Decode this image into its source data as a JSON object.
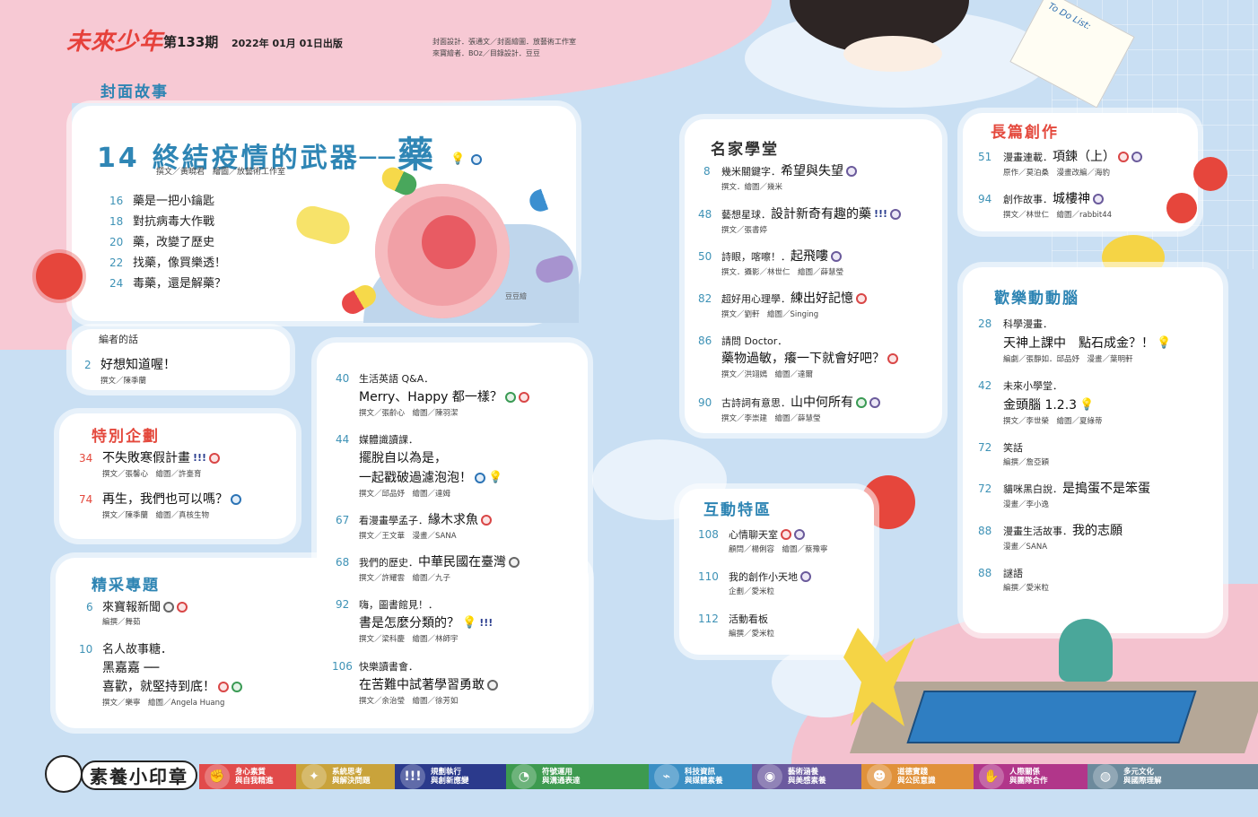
{
  "header": {
    "logo": "未來少年",
    "issue": "第133期",
    "date": "2022年 01月 01日出版",
    "credit_line1": "封面設計．張通文／封面繪圖．放藝術工作室",
    "credit_line2": "來寶繪者．BOz／目錄設計．豆豆"
  },
  "cover": {
    "section": "封面故事",
    "number": "14",
    "title": "終結疫情的武器──",
    "title_big": "藥",
    "credit": "撰文／黃曉君　繪圖／放藝術工作室",
    "items": [
      {
        "page": "16",
        "title": "藥是一把小鑰匙"
      },
      {
        "page": "18",
        "title": "對抗病毒大作戰"
      },
      {
        "page": "20",
        "title": "藥，改變了歷史"
      },
      {
        "page": "22",
        "title": "找藥，像買樂透！"
      },
      {
        "page": "24",
        "title": "毒藥，還是解藥？"
      }
    ],
    "illustrator_tag": "豆豆繪"
  },
  "editor": {
    "label": "編者的話",
    "page": "2",
    "title": "好想知道喔！",
    "credit": "撰文／陳季蘭"
  },
  "special": {
    "section": "特別企劃",
    "items": [
      {
        "page": "34",
        "title": "不失敗寒假計畫",
        "credit": "撰文／張馨心　繪圖／許臺育"
      },
      {
        "page": "74",
        "title": "再生，我們也可以嗎？",
        "credit": "撰文／陳季蘭　繪圖／真核生物"
      }
    ]
  },
  "feature": {
    "section": "精采專題",
    "items": [
      {
        "page": "6",
        "title": "來寶報新聞",
        "credit": "編撰／舞茹"
      },
      {
        "page": "10",
        "series": "名人故事糖．",
        "title1": "黑嘉嘉 ──",
        "title2": "喜歡，就堅持到底！",
        "credit": "撰文／樂寧　繪圖／Angela Huang"
      }
    ]
  },
  "middle": {
    "items": [
      {
        "page": "40",
        "series": "生活英語 Q&A．",
        "title": "Merry、Happy 都一樣？",
        "credit": "撰文／張齡心　繪圖／陳羽潔"
      },
      {
        "page": "44",
        "series": "媒體識讀課．",
        "title1": "擺脫自以為是，",
        "title2": "一起戳破過濾泡泡！",
        "credit": "撰文／邱品妤　繪圖／達姆"
      },
      {
        "page": "67",
        "series": "看漫畫學孟子．",
        "title": "緣木求魚",
        "credit": "撰文／王文華　漫畫／SANA"
      },
      {
        "page": "68",
        "series": "我們的歷史．",
        "title": "中華民國在臺灣",
        "credit": "撰文／許耀雲　繪圖／九子"
      },
      {
        "page": "92",
        "series": "嗨，圖書館見！．",
        "title": "書是怎麼分類的？",
        "credit": "撰文／梁科慶　繪圖／林師宇"
      },
      {
        "page": "106",
        "series": "快樂讀書會．",
        "title": "在苦難中試著學習勇敢",
        "credit": "撰文／余治瑩　繪圖／徐芳如"
      }
    ]
  },
  "masters": {
    "section": "名家學堂",
    "items": [
      {
        "page": "8",
        "series": "幾米關鍵字．",
        "title": "希望與失望",
        "credit": "撰文．繪圖／幾米"
      },
      {
        "page": "48",
        "series": "藝想星球．",
        "title": "設計新奇有趣的藥",
        "credit": "撰文／張書婷"
      },
      {
        "page": "50",
        "series": "詩眼，喀嚓！．",
        "title": "起飛嘍",
        "credit": "撰文．攝影／林世仁　繪圖／薛慧瑩"
      },
      {
        "page": "82",
        "series": "超好用心理學．",
        "title": "練出好記憶",
        "credit": "撰文／劉軒　繪圖／Singing"
      },
      {
        "page": "86",
        "series": "請問 Doctor．",
        "title": "藥物過敏，癢一下就會好吧？",
        "credit": "撰文／洪翊嫣　繪圖／達爾"
      },
      {
        "page": "90",
        "series": "古詩詞有意思．",
        "title": "山中何所有",
        "credit": "撰文／李崇建　繪圖／薛慧瑩"
      }
    ]
  },
  "interactive": {
    "section": "互動特區",
    "items": [
      {
        "page": "108",
        "title": "心情聊天室",
        "credit": "顧問／楊俐容　繪圖／蔡豫寧"
      },
      {
        "page": "110",
        "title": "我的創作小天地",
        "credit": "企劃／愛米粒"
      },
      {
        "page": "112",
        "title": "活動看板",
        "credit": "編撰／愛米粒"
      }
    ]
  },
  "longform": {
    "section": "長篇創作",
    "items": [
      {
        "page": "51",
        "series": "漫畫連載．",
        "title": "項鍊（上）",
        "credit": "原作／莫泊桑　漫畫改編／海豹"
      },
      {
        "page": "94",
        "series": "創作故事．",
        "title": "城樓神",
        "credit": "撰文／林世仁　繪圖／rabbit44"
      }
    ]
  },
  "fun": {
    "section": "歡樂動動腦",
    "items": [
      {
        "page": "28",
        "series": "科學漫畫．",
        "title": "天神上課中　點石成金？！",
        "credit": "編劇／張靜如．邱品妤　漫畫／葉明軒"
      },
      {
        "page": "42",
        "series": "未來小學堂．",
        "title": "金頭腦 1.2.3",
        "credit": "撰文／李世榮　繪圖／夏綠蒂"
      },
      {
        "page": "72",
        "title": "笑話",
        "credit": "編撰／詹亞穎"
      },
      {
        "page": "72",
        "series": "貓咪黑白說．",
        "title": "是搗蛋不是笨蛋",
        "credit": "漫畫／李小逸"
      },
      {
        "page": "88",
        "series": "漫畫生活故事．",
        "title": "我的志願",
        "credit": "漫畫／SANA"
      },
      {
        "page": "88",
        "title": "謎語",
        "credit": "編撰／愛米粒"
      }
    ]
  },
  "footer": {
    "label": "素養小印章",
    "segments": [
      {
        "l1": "身心素質",
        "l2": "與自我精進",
        "color": "#e14b4b",
        "icon": "fist-icon"
      },
      {
        "l1": "系統思考",
        "l2": "與解決問題",
        "color": "#c9a33b",
        "icon": "bulb-icon"
      },
      {
        "l1": "規劃執行",
        "l2": "與創新應變",
        "color": "#2b3a8c",
        "icon": "burst-icon"
      },
      {
        "l1": "符號運用",
        "l2": "與溝通表達",
        "color": "#3d9a4f",
        "icon": "chat-icon"
      },
      {
        "l1": "科技資訊",
        "l2": "與媒體素養",
        "color": "#3b8fc4",
        "icon": "tech-icon"
      },
      {
        "l1": "藝術涵養",
        "l2": "與美感素養",
        "color": "#6b5a9f",
        "icon": "palette-icon"
      },
      {
        "l1": "道德實踐",
        "l2": "與公民意識",
        "color": "#e0913a",
        "icon": "people-icon"
      },
      {
        "l1": "人際關係",
        "l2": "與團隊合作",
        "color": "#b1368a",
        "icon": "handshake-icon"
      },
      {
        "l1": "多元文化",
        "l2": "與國際理解",
        "color": "#6c8a9c",
        "icon": "globe-icon"
      }
    ]
  },
  "decor_text": {
    "todo": "To Do List:"
  }
}
